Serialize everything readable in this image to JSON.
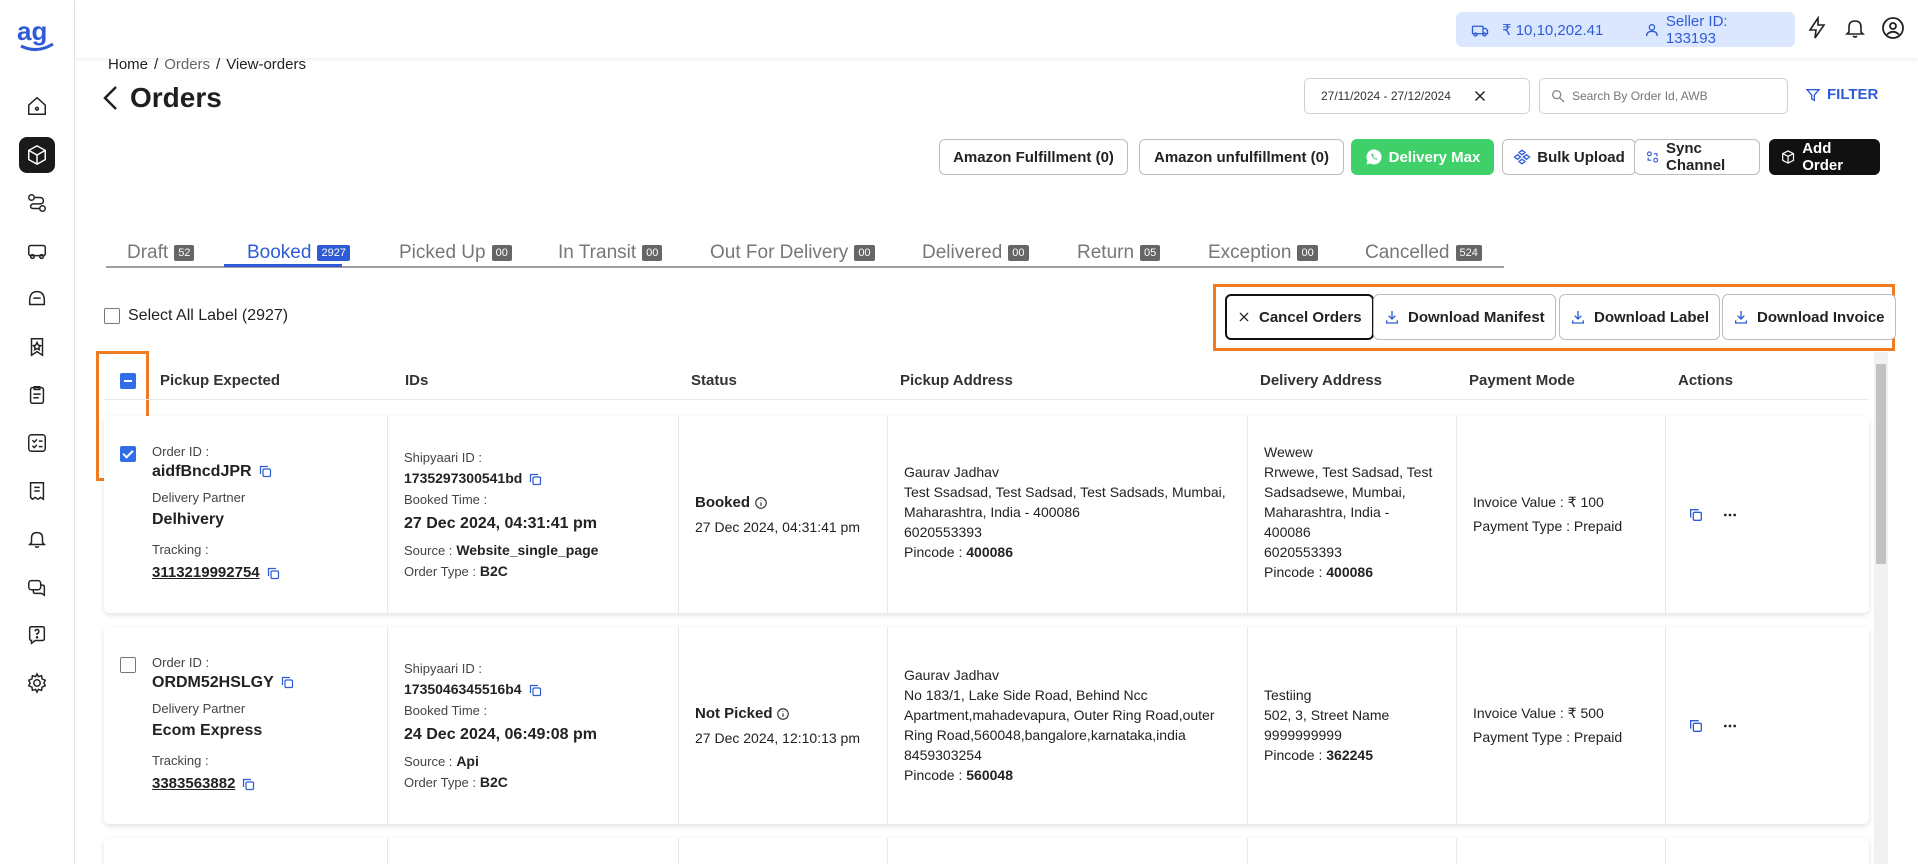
{
  "brand": {
    "logo_text": "ag",
    "accent": "#2f5cd6",
    "highlight": "#f07b22"
  },
  "topbar": {
    "wallet": "₹ 10,10,202.41",
    "seller": "Seller ID: 133193"
  },
  "breadcrumb": {
    "home": "Home",
    "orders": "Orders",
    "current": "View-orders",
    "sep": "/"
  },
  "title": "Orders",
  "date_range": "27/11/2024 - 27/12/2024",
  "search_placeholder": "Search By Order Id, AWB",
  "filter_label": "FILTER",
  "buttons": {
    "amazon_fulfillment": "Amazon Fulfillment (0)",
    "amazon_unfulfillment": "Amazon unfulfillment (0)",
    "delivery_max": "Delivery Max",
    "bulk_upload": "Bulk Upload",
    "sync_channel": "Sync Channel",
    "add_order": "Add Order"
  },
  "tabs": [
    {
      "label": "Draft",
      "count": "52"
    },
    {
      "label": "Booked",
      "count": "2927"
    },
    {
      "label": "Picked Up",
      "count": "00"
    },
    {
      "label": "In Transit",
      "count": "00"
    },
    {
      "label": "Out For Delivery",
      "count": "00"
    },
    {
      "label": "Delivered",
      "count": "00"
    },
    {
      "label": "Return",
      "count": "05"
    },
    {
      "label": "Exception",
      "count": "00"
    },
    {
      "label": "Cancelled",
      "count": "524"
    }
  ],
  "select_all": "Select All Label (2927)",
  "actions": {
    "cancel": "Cancel Orders",
    "manifest": "Download Manifest",
    "label": "Download Label",
    "invoice": "Download Invoice"
  },
  "columns": [
    "Pickup Expected",
    "IDs",
    "Status",
    "Pickup Address",
    "Delivery Address",
    "Payment Mode",
    "Actions"
  ],
  "rows": [
    {
      "order_id_label": "Order ID :",
      "order_id": "aidfBncdJPR",
      "partner_label": "Delivery Partner",
      "partner": "Delhivery",
      "tracking_label": "Tracking :",
      "tracking": "3113219992754",
      "shipyaari_label": "Shipyaari ID :",
      "shipyaari_id": "1735297300541bd",
      "booked_label": "Booked Time :",
      "booked_time": "27 Dec 2024, 04:31:41 pm",
      "source_label": "Source :",
      "source": "Website_single_page",
      "order_type_label": "Order Type :",
      "order_type": "B2C",
      "status": "Booked",
      "status_time": "27 Dec 2024, 04:31:41 pm",
      "pickup_lines": [
        "Gaurav Jadhav",
        "Test Ssadsad, Test Sadsad, Test Sadsads, Mumbai,",
        "Maharashtra, India - 400086",
        "6020553393"
      ],
      "pickup_pincode": "400086",
      "delivery_lines": [
        "Wewew",
        "Rrwewe, Test Sadsad, Test",
        "Sadsadsewe, Mumbai,",
        "Maharashtra, India -",
        "400086",
        "6020553393"
      ],
      "delivery_pincode": "400086",
      "invoice": "Invoice Value : ₹ 100",
      "payment_type": "Payment Type : Prepaid"
    },
    {
      "order_id_label": "Order ID :",
      "order_id": "ORDM52HSLGY",
      "partner_label": "Delivery Partner",
      "partner": "Ecom Express",
      "tracking_label": "Tracking :",
      "tracking": "3383563882",
      "shipyaari_label": "Shipyaari ID :",
      "shipyaari_id": "1735046345516b4",
      "booked_label": "Booked Time :",
      "booked_time": "24 Dec 2024, 06:49:08 pm",
      "source_label": "Source :",
      "source": "Api",
      "order_type_label": "Order Type :",
      "order_type": "B2C",
      "status": "Not Picked",
      "status_time": "27 Dec 2024, 12:10:13 pm",
      "pickup_lines": [
        "Gaurav Jadhav",
        "No 183/1, Lake Side Road, Behind Ncc",
        "Apartment,mahadevapura, Outer Ring Road,outer",
        "Ring Road,560048,bangalore,karnataka,india",
        "8459303254"
      ],
      "pickup_pincode": "560048",
      "delivery_lines": [
        "Testiing",
        "502, 3, Street Name",
        "9999999999"
      ],
      "delivery_pincode": "362245",
      "invoice": "Invoice Value : ₹ 500",
      "payment_type": "Payment Type : Prepaid"
    }
  ],
  "pincode_label": "Pincode :"
}
